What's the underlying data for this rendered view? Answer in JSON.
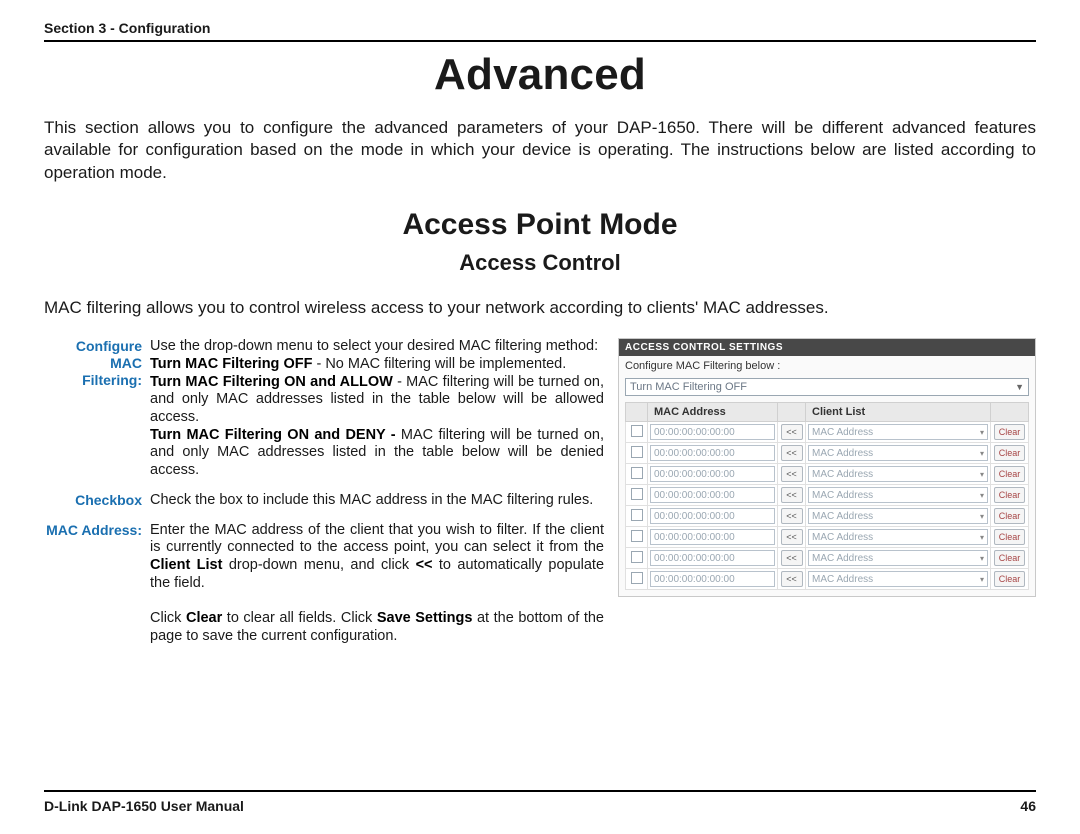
{
  "header": {
    "section": "Section 3 - Configuration"
  },
  "title": "Advanced",
  "intro": "This section allows you to configure the advanced parameters of your DAP-1650. There will be different advanced features available for configuration based on the mode in which your device is operating. The instructions below are listed according to operation mode.",
  "mode_title": "Access Point Mode",
  "sub_title": "Access Control",
  "desc": "MAC filtering allows you to control wireless access to your network according to clients' MAC addresses.",
  "defs": {
    "cfg_label_a": "Configure MAC",
    "cfg_label_b": "Filtering:",
    "cfg_intro": "Use the drop-down menu to select your desired MAC filtering method:",
    "cfg_off_b": "Turn MAC Filtering OFF",
    "cfg_off_t": " - No MAC filtering will be implemented.",
    "cfg_allow_b": "Turn MAC Filtering ON and ALLOW",
    "cfg_allow_t": " - MAC filtering will be turned on, and only MAC addresses listed in the table below will be allowed access.",
    "cfg_deny_b": "Turn MAC Filtering ON and DENY - ",
    "cfg_deny_t": "MAC filtering will be turned on, and only MAC addresses listed in the table below will be denied access.",
    "cb_label": "Checkbox",
    "cb_body": "Check the box to include this MAC address in the MAC filtering rules.",
    "mac_label": "MAC Address:",
    "mac_body_a": "Enter the MAC address of the client that you wish to filter. If the client is currently connected to the access point, you can select it from the ",
    "mac_body_b": "Client List",
    "mac_body_c": " drop-down menu, and click ",
    "mac_body_d": "<<",
    "mac_body_e": " to automatically populate the field.",
    "mac_extra_a": "Click ",
    "mac_extra_b": "Clear",
    "mac_extra_c": " to clear all fields. Click ",
    "mac_extra_d": "Save Settings",
    "mac_extra_e": " at the bottom of the page to save the current configuration."
  },
  "panel": {
    "title": "ACCESS CONTROL SETTINGS",
    "subtitle": "Configure MAC Filtering below :",
    "dropdown_value": "Turn MAC Filtering OFF",
    "th_mac": "MAC Address",
    "th_client": "Client List",
    "arrow": "<<",
    "clear": "Clear",
    "client_placeholder": "MAC Address",
    "rows": [
      {
        "mac": "00:00:00:00:00:00"
      },
      {
        "mac": "00:00:00:00:00:00"
      },
      {
        "mac": "00:00:00:00:00:00"
      },
      {
        "mac": "00:00:00:00:00:00"
      },
      {
        "mac": "00:00:00:00:00:00"
      },
      {
        "mac": "00:00:00:00:00:00"
      },
      {
        "mac": "00:00:00:00:00:00"
      },
      {
        "mac": "00:00:00:00:00:00"
      }
    ]
  },
  "footer": {
    "left": "D-Link DAP-1650 User Manual",
    "right": "46"
  }
}
